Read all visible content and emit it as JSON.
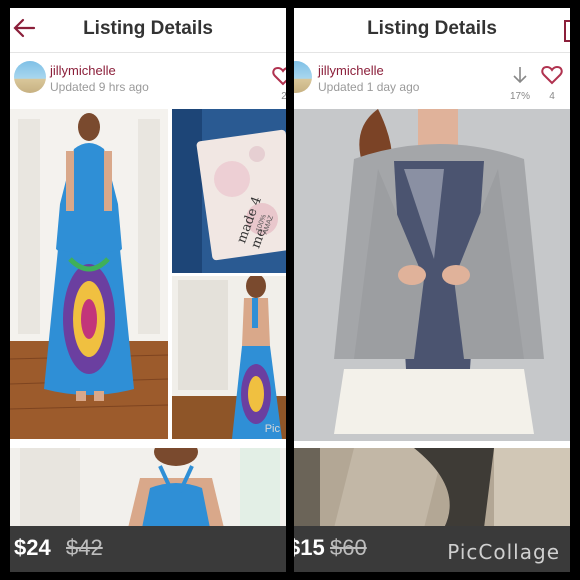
{
  "collage": {
    "watermark": "PicCollage"
  },
  "left": {
    "header": {
      "title": "Listing Details",
      "back_icon": "arrow-left-icon"
    },
    "seller": {
      "username": "jillymichelle",
      "updated": "Updated 9 hrs ago",
      "likes": "2"
    },
    "price": {
      "current": "$24",
      "original": "$42"
    },
    "photos": {
      "tag_text": "made 4 me",
      "tag_subtext": "100% AMAZ"
    },
    "watermark_small": "Pic"
  },
  "right": {
    "header": {
      "title": "Listing Details"
    },
    "seller": {
      "username": "jillymichelle",
      "updated": "Updated 1 day ago",
      "price_drop": "17%",
      "likes": "4"
    },
    "price": {
      "current": "$15",
      "original": "$60"
    }
  },
  "colors": {
    "accent": "#8b1f3a",
    "heart": "#b0324f",
    "price_bar": "#3a3a3a",
    "dress_blue": "#2f8fd6"
  }
}
